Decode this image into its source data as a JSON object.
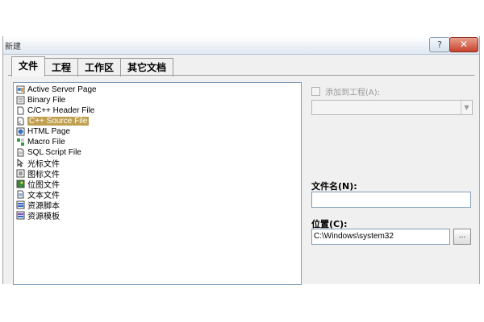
{
  "window": {
    "title": "新建",
    "help_label": "?",
    "close_label": "✕"
  },
  "tabs": [
    {
      "label": "文件",
      "active": true
    },
    {
      "label": "工程",
      "active": false
    },
    {
      "label": "工作区",
      "active": false
    },
    {
      "label": "其它文档",
      "active": false
    }
  ],
  "file_types": [
    {
      "label": "Active Server Page",
      "icon": "asp-icon"
    },
    {
      "label": "Binary File",
      "icon": "binary-file-icon"
    },
    {
      "label": "C/C++ Header File",
      "icon": "header-file-icon"
    },
    {
      "label": "C++ Source File",
      "icon": "cpp-source-icon",
      "selected": true
    },
    {
      "label": "HTML Page",
      "icon": "html-page-icon"
    },
    {
      "label": "Macro File",
      "icon": "macro-file-icon"
    },
    {
      "label": "SQL Script File",
      "icon": "sql-script-icon"
    },
    {
      "label": "光标文件",
      "icon": "cursor-file-icon"
    },
    {
      "label": "图标文件",
      "icon": "icon-file-icon"
    },
    {
      "label": "位图文件",
      "icon": "bitmap-file-icon"
    },
    {
      "label": "文本文件",
      "icon": "text-file-icon"
    },
    {
      "label": "资源脚本",
      "icon": "resource-script-icon"
    },
    {
      "label": "资源模板",
      "icon": "resource-template-icon"
    }
  ],
  "add_to_project": {
    "label": "添加到工程(A):",
    "checked": false,
    "enabled": false
  },
  "project_select": {
    "value": ""
  },
  "file_name": {
    "label": "文件名(N):",
    "value": ""
  },
  "location": {
    "label": "位置(C):",
    "value": "C:\\Windows\\system32",
    "browse_label": "..."
  },
  "colors": {
    "selection": "#c0a050",
    "dialog_bg": "#f0f0f0"
  }
}
